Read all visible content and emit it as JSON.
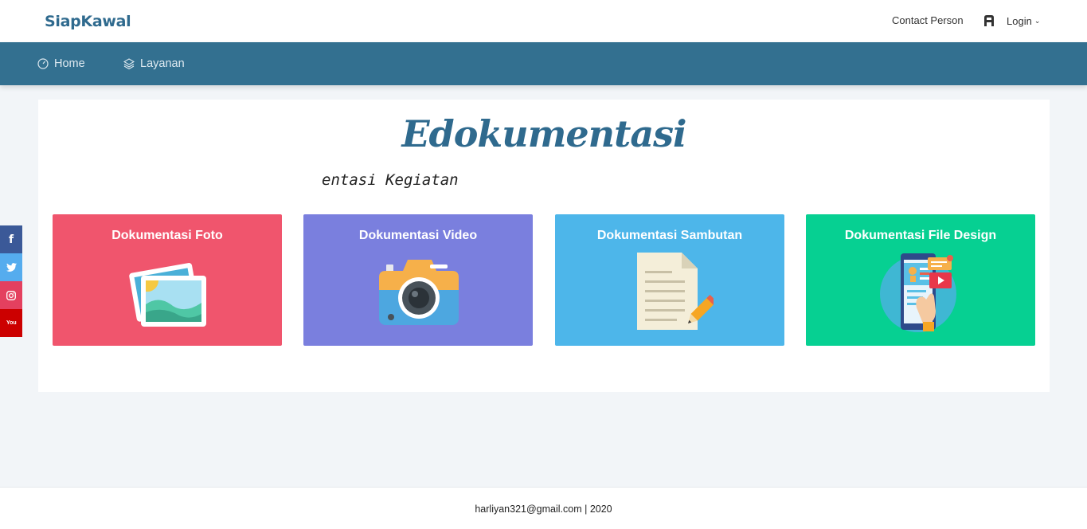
{
  "header": {
    "brand": "SiapKawal",
    "contact_label": "Contact Person",
    "login_label": "Login"
  },
  "nav": {
    "items": [
      {
        "label": "Home",
        "icon": "dashboard-icon"
      },
      {
        "label": "Layanan",
        "icon": "layers-icon"
      }
    ]
  },
  "main": {
    "title": "Edokumentasi",
    "subtitle": "entasi Kegiatan",
    "cards": [
      {
        "label": "Dokumentasi Foto",
        "icon": "photo-icon",
        "color": "#f0556d"
      },
      {
        "label": "Dokumentasi Video",
        "icon": "camera-icon",
        "color": "#7a7fde"
      },
      {
        "label": "Dokumentasi Sambutan",
        "icon": "document-icon",
        "color": "#4db6ea"
      },
      {
        "label": "Dokumentasi File Design",
        "icon": "mobile-design-icon",
        "color": "#06d092"
      }
    ]
  },
  "social": {
    "facebook_glyph": "f",
    "twitter_icon": "twitter-icon",
    "instagram_icon": "instagram-icon",
    "youtube_glyph": "You"
  },
  "footer": {
    "text": "harliyan321@gmail.com | 2020"
  }
}
